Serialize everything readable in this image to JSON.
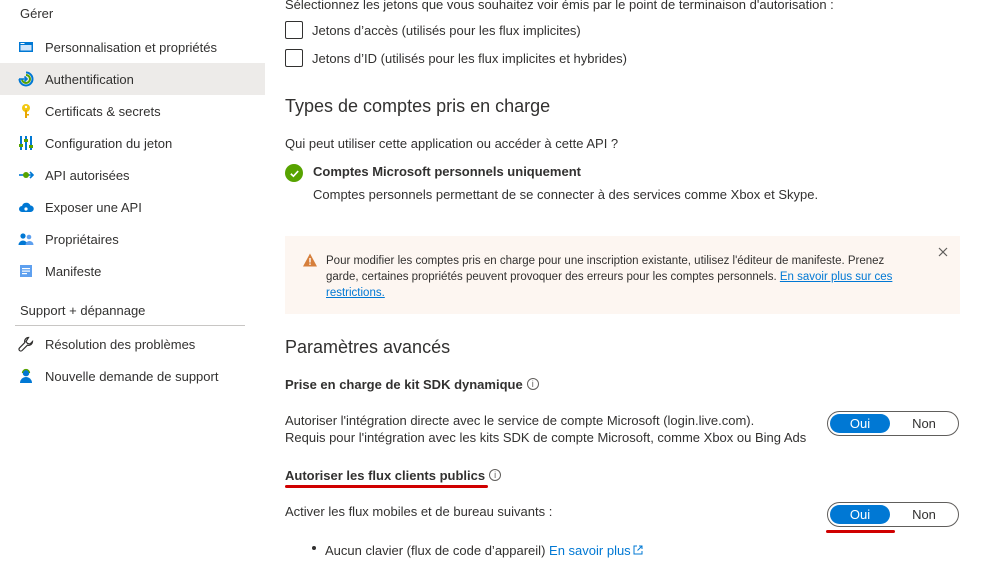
{
  "sidebar": {
    "manage_title": "Gérer",
    "support_title": "Support + dépannage",
    "manage_items": [
      {
        "label": "Personnalisation et propriétés",
        "icon": "branding-icon"
      },
      {
        "label": "Authentification",
        "icon": "authentication-icon"
      },
      {
        "label": "Certificats & secrets",
        "icon": "key-icon"
      },
      {
        "label": "Configuration du jeton",
        "icon": "token-config-icon"
      },
      {
        "label": "API autorisées",
        "icon": "api-permissions-icon"
      },
      {
        "label": "Exposer une API",
        "icon": "cloud-icon"
      },
      {
        "label": "Propriétaires",
        "icon": "owners-icon"
      },
      {
        "label": "Manifeste",
        "icon": "manifest-icon"
      }
    ],
    "support_items": [
      {
        "label": "Résolution des problèmes",
        "icon": "wrench-icon"
      },
      {
        "label": "Nouvelle demande de support",
        "icon": "support-person-icon"
      }
    ],
    "active_item": "Authentification"
  },
  "tokens": {
    "intro": "Sélectionnez les jetons que vous souhaitez voir émis par le point de terminaison d'autorisation :",
    "access_label": "Jetons d’accès (utilisés pour les flux implicites)",
    "id_label": "Jetons d’ID (utilisés pour les flux implicites et hybrides)",
    "access_checked": false,
    "id_checked": false
  },
  "account_types": {
    "heading": "Types de comptes pris en charge",
    "question": "Qui peut utiliser cette application ou accéder à cette API ?",
    "selected_title": "Comptes Microsoft personnels uniquement",
    "selected_desc": "Comptes personnels permettant de se connecter à des services comme Xbox et Skype."
  },
  "warning": {
    "text": "Pour modifier les comptes pris en charge pour une inscription existante, utilisez l'éditeur de manifeste. Prenez garde, certaines propriétés peuvent provoquer des erreurs pour les comptes personnels.",
    "link": "En savoir plus sur ces restrictions."
  },
  "advanced": {
    "heading": "Paramètres avancés",
    "sdk_title": "Prise en charge de kit SDK dynamique",
    "sdk_desc1": "Autoriser l'intégration directe avec le service de compte Microsoft (login.live.com).",
    "sdk_desc2": "Requis pour l'intégration avec les kits SDK de compte Microsoft, comme Xbox ou Bing Ads",
    "public_title": "Autoriser les flux clients publics",
    "public_desc": "Activer les flux mobiles et de bureau suivants :",
    "bullet_text": "Aucun clavier (flux de code d’appareil)",
    "bullet_link": "En savoir plus",
    "yes_label": "Oui",
    "no_label": "Non",
    "sdk_value": "Oui",
    "public_value": "Oui"
  },
  "colors": {
    "accent": "#0078d4",
    "success": "#57a300",
    "warning_bg": "#fdf6f1",
    "warning_icon": "#d67f3c",
    "highlight_red": "#d00000",
    "active_nav_bg": "#edebe9"
  }
}
